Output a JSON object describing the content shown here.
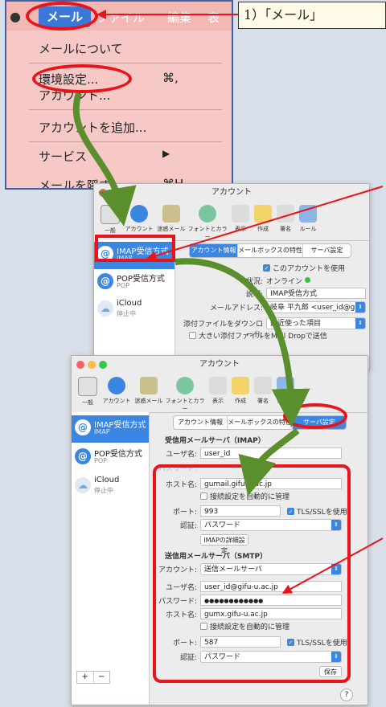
{
  "menu": {
    "bar": {
      "mail": "メール",
      "file": "ファイル",
      "edit": "編集",
      "view": "表"
    },
    "items": [
      {
        "label": "メールについて",
        "shortcut": ""
      },
      {
        "label": "環境設定...",
        "shortcut": "⌘,"
      },
      {
        "label": "アカウント...",
        "shortcut": ""
      },
      {
        "label": "アカウントを追加...",
        "shortcut": ""
      },
      {
        "label": "サービス",
        "shortcut": "▶"
      },
      {
        "label": "メールを隠す",
        "shortcut": "⌘H"
      }
    ]
  },
  "callout": {
    "text": "1）「メール」"
  },
  "toolbar": {
    "general": "一般",
    "accounts": "アカウント",
    "junk": "迷惑メール",
    "fonts": "フォントとカラー",
    "view": "表示",
    "compose": "作成",
    "signature": "署名",
    "rules": "ルール"
  },
  "window1": {
    "title": "アカウント",
    "accounts": [
      {
        "name": "IMAP受信方式",
        "sub": "IMAP"
      },
      {
        "name": "POP受信方式",
        "sub": "POP"
      },
      {
        "name": "iCloud",
        "sub": "停止中"
      }
    ],
    "tabs": [
      "アカウント情報",
      "メールボックスの特性",
      "サーバ設定"
    ],
    "use_account": "このアカウントを使用",
    "status_label": "状況:",
    "status_value": "オンライン",
    "desc_label": "説明:",
    "desc_value": "IMAP受信方式",
    "address_label": "メールアドレス:",
    "address_value": "岐阜 平九郎 <user_id@gifu-u.a...",
    "download_label": "添付ファイルをダウンロード:",
    "download_value": "最近使った項目",
    "send_large": "大きい添付ファイルをMail Dropで送信"
  },
  "window2": {
    "title": "アカウント",
    "accounts": [
      {
        "name": "IMAP受信方式",
        "sub": "IMAP"
      },
      {
        "name": "POP受信方式",
        "sub": "POP"
      },
      {
        "name": "iCloud",
        "sub": "停止中"
      }
    ],
    "tabs": [
      "アカウント情報",
      "メールボックスの特性",
      "サーバ設定"
    ],
    "imap_head": "受信用メールサーバ（IMAP）",
    "username_label": "ユーザ名:",
    "username_value": "user_id",
    "password_label": "パスワード:",
    "host_label": "ホスト名:",
    "host_value": "gumail.gifu-u.ac.jp",
    "auto_manage": "接続設定を自動的に管理",
    "port_label": "ポート:",
    "port_value": "993",
    "tls": "TLS/SSLを使用",
    "auth_label": "認証:",
    "auth_value": "パスワード",
    "imap_advanced": "IMAPの詳細設定",
    "smtp_head": "送信用メールサーバ（SMTP）",
    "account_label": "アカウント:",
    "account_value": "送信メールサーバ",
    "smtp_user_label": "ユーザ名:",
    "smtp_user_value": "user_id@gifu-u.ac.jp",
    "smtp_pass_label": "パスワード:",
    "smtp_pass_value": "●●●●●●●●●●●●",
    "smtp_host_label": "ホスト名:",
    "smtp_host_value": "gumx.gifu-u.ac.jp",
    "smtp_auto": "接続設定を自動的に管理",
    "smtp_port_label": "ポート:",
    "smtp_port_value": "587",
    "smtp_tls": "TLS/SSLを使用",
    "smtp_auth_label": "認証:",
    "smtp_auth_value": "パスワード",
    "save": "保存",
    "add": "+",
    "remove": "−",
    "help": "?"
  },
  "colors": {
    "accent": "#3b86e0",
    "highlight": "#e8141a",
    "arrow_green": "#5b8f2e",
    "arrow_red": "#e8141a"
  }
}
